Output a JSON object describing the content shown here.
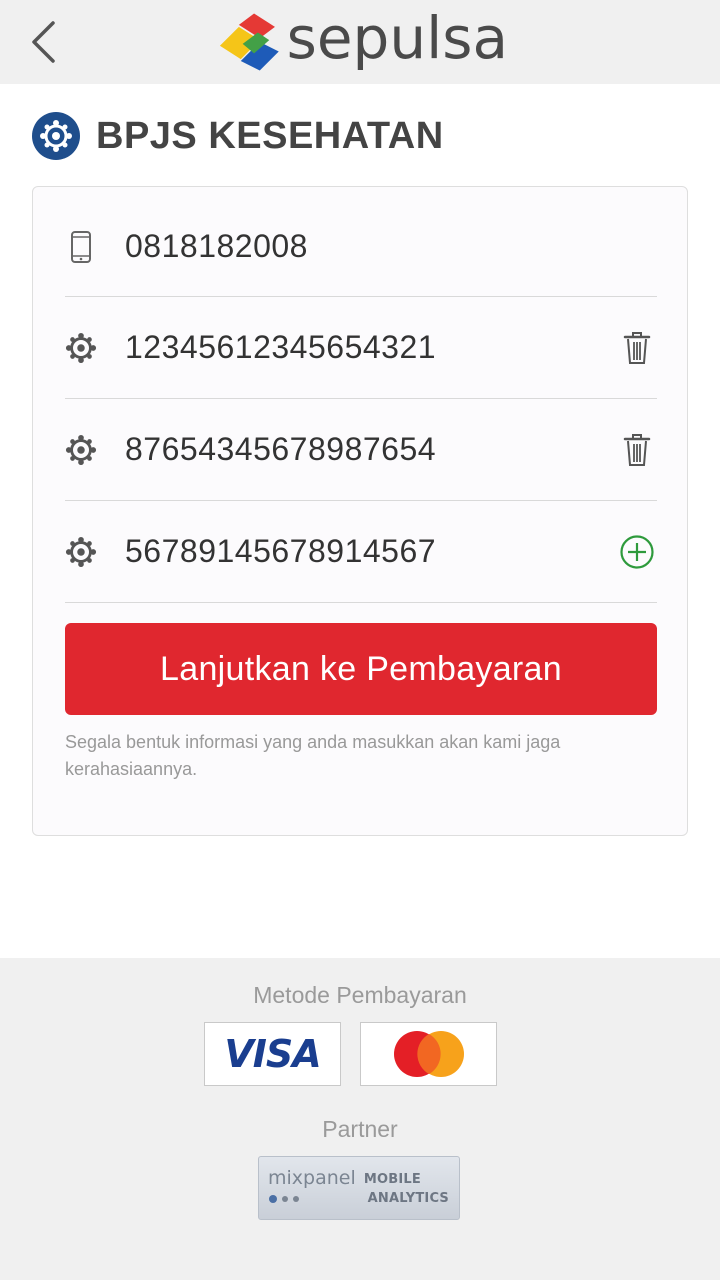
{
  "header": {
    "back_icon": "chevron-left-icon",
    "logo_text": "sepulsa"
  },
  "page": {
    "title": "BPJS KESEHATAN",
    "title_icon": "bpjs-icon"
  },
  "form": {
    "phone": {
      "icon": "phone-icon",
      "value": "0818182008"
    },
    "numbers": [
      {
        "icon": "bpjs-icon",
        "value": "12345612345654321",
        "action": "delete",
        "action_icon": "trash-icon"
      },
      {
        "icon": "bpjs-icon",
        "value": "87654345678987654",
        "action": "delete",
        "action_icon": "trash-icon"
      },
      {
        "icon": "bpjs-icon",
        "value": "56789145678914567",
        "action": "add",
        "action_icon": "add-circle-icon"
      }
    ],
    "submit_label": "Lanjutkan ke Pembayaran",
    "privacy_note": "Segala bentuk informasi yang anda masukkan akan kami jaga kerahasiaannya."
  },
  "footer": {
    "payment_heading": "Metode Pembayaran",
    "payment_methods": [
      "VISA",
      "MasterCard"
    ],
    "partner_heading": "Partner",
    "partner_brand": "mixpanel",
    "partner_sub_1": "MOBILE",
    "partner_sub_2": "ANALYTICS"
  },
  "colors": {
    "accent_red": "#e0272f",
    "brand_blue": "#1f4e8c",
    "add_green": "#2e9a3c",
    "header_bg": "#f0f0f0"
  }
}
